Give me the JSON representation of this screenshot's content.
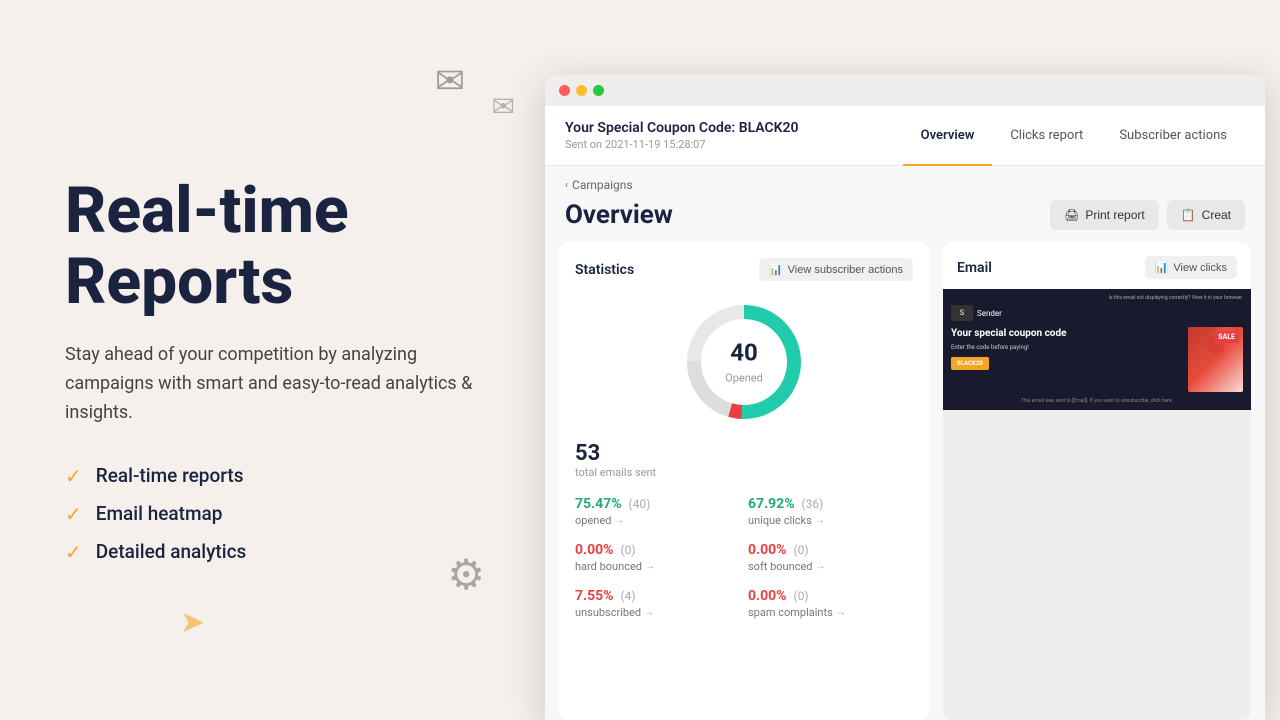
{
  "left": {
    "hero_title": "Real-time Reports",
    "subtitle": "Stay ahead of your competition by analyzing campaigns with smart and easy-to-read analytics & insights.",
    "features": [
      {
        "id": "real-time",
        "label": "Real-time reports"
      },
      {
        "id": "heatmap",
        "label": "Email heatmap"
      },
      {
        "id": "analytics",
        "label": "Detailed analytics"
      }
    ]
  },
  "browser": {
    "campaign_title": "Your Special Coupon Code: BLACK20",
    "campaign_date": "Sent on 2021-11-19 15:28:07",
    "tabs": [
      {
        "id": "overview",
        "label": "Overview",
        "active": true
      },
      {
        "id": "clicks",
        "label": "Clicks report",
        "active": false
      },
      {
        "id": "subscriber",
        "label": "Subscriber actions",
        "active": false
      }
    ],
    "breadcrumb": "Campaigns",
    "page_title": "Overview",
    "buttons": {
      "print": "Print report",
      "create": "Creat"
    },
    "stats": {
      "section_title": "Statistics",
      "view_btn": "View subscriber actions",
      "donut": {
        "value": 40,
        "label": "Opened"
      },
      "total": {
        "number": 53,
        "label": "total emails sent"
      },
      "metrics": [
        {
          "pct": "75.47%",
          "count": "(40)",
          "name": "opened",
          "color": "green"
        },
        {
          "pct": "67.92%",
          "count": "(36)",
          "name": "unique clicks",
          "color": "green"
        },
        {
          "pct": "0.00%",
          "count": "(0)",
          "name": "hard bounced",
          "color": "red"
        },
        {
          "pct": "0.00%",
          "count": "(0)",
          "name": "soft bounced",
          "color": "red"
        },
        {
          "pct": "7.55%",
          "count": "(4)",
          "name": "unsubscribed",
          "color": "red"
        },
        {
          "pct": "0.00%",
          "count": "(0)",
          "name": "spam complaints",
          "color": "red"
        }
      ]
    },
    "email": {
      "section_title": "Email",
      "view_btn": "View clicks",
      "preview": {
        "top_bar": "Is this email not displaying correctly? View it in your browser.",
        "logo": "Sender",
        "headline": "Your special coupon code",
        "subtext": "Enter the code before paying!",
        "cta": "BLACK20",
        "sale_badge": "SALE",
        "footer": "This email was sent to [Email]. If you want to unsubscribe, click here."
      }
    }
  }
}
